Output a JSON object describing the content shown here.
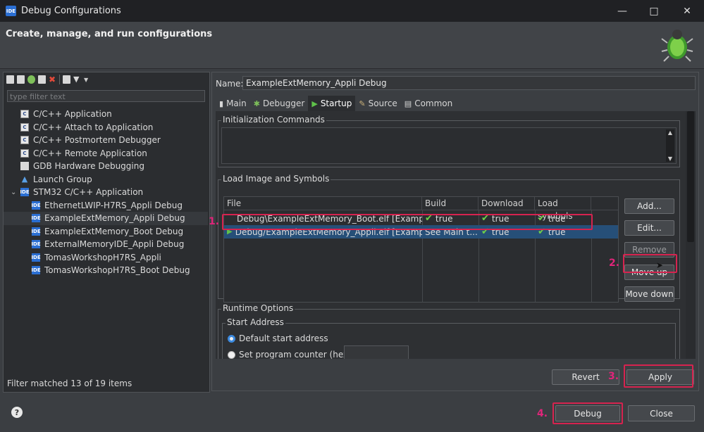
{
  "window": {
    "title": "Debug Configurations",
    "app_icon": "IDE"
  },
  "banner": {
    "title": "Create, manage, and run configurations"
  },
  "left": {
    "filter_placeholder": "type filter text",
    "tree": [
      {
        "label": "C/C++ Application",
        "icon": "c-icon"
      },
      {
        "label": "C/C++ Attach to Application",
        "icon": "c-icon"
      },
      {
        "label": "C/C++ Postmortem Debugger",
        "icon": "c-icon"
      },
      {
        "label": "C/C++ Remote Application",
        "icon": "c-icon"
      },
      {
        "label": "GDB Hardware Debugging",
        "icon": "gdb-icon"
      },
      {
        "label": "Launch Group",
        "icon": "launch-group-icon"
      },
      {
        "label": "STM32 C/C++ Application",
        "icon": "ide-icon"
      },
      {
        "label": "EthernetLWIP-H7RS_Appli Debug",
        "icon": "ide-icon"
      },
      {
        "label": "ExampleExtMemory_Appli Debug",
        "icon": "ide-icon"
      },
      {
        "label": "ExampleExtMemory_Boot Debug",
        "icon": "ide-icon"
      },
      {
        "label": "ExternalMemoryIDE_Appli Debug",
        "icon": "ide-icon"
      },
      {
        "label": "TomasWorkshopH7RS_Appli",
        "icon": "ide-icon"
      },
      {
        "label": "TomasWorkshopH7RS_Boot Debug",
        "icon": "ide-icon"
      }
    ],
    "status": "Filter matched 13 of 19 items"
  },
  "right": {
    "name_label": "Name:",
    "name_value": "ExampleExtMemory_Appli Debug",
    "tabs": [
      {
        "label": "Main",
        "icon": "main-icon"
      },
      {
        "label": "Debugger",
        "icon": "debugger-icon"
      },
      {
        "label": "Startup",
        "icon": "startup-icon"
      },
      {
        "label": "Source",
        "icon": "source-icon"
      },
      {
        "label": "Common",
        "icon": "common-icon"
      }
    ],
    "active_tab": "Startup",
    "init_label": "Initialization Commands",
    "load_label": "Load Image and Symbols",
    "table": {
      "headers": [
        "File",
        "Build",
        "Download",
        "Load symbols"
      ],
      "rows": [
        {
          "file": "Debug\\ExampleExtMemory_Boot.elf [ExampleE...",
          "build": "true",
          "download": "true",
          "symbols": "true"
        },
        {
          "file": "Debug/ExampleExtMemory_Appli.elf [Example...",
          "build": "See Main t...",
          "download": "true",
          "symbols": "true"
        }
      ]
    },
    "side_buttons": {
      "add": "Add...",
      "edit": "Edit...",
      "remove": "Remove",
      "move_up": "Move up",
      "move_down": "Move down"
    },
    "runtime_label": "Runtime Options",
    "start_address_label": "Start Address",
    "radio_default": "Default start address",
    "radio_pc": "Set program counter (hex):",
    "revert": "Revert",
    "apply": "Apply"
  },
  "footer": {
    "debug": "Debug",
    "close": "Close"
  },
  "steps": [
    "1.",
    "2.",
    "3.",
    "4."
  ],
  "colors": {
    "annotation": "#d6234f",
    "step_text": "#e0257a",
    "check": "#6ecf4a",
    "selection": "#264f78"
  }
}
